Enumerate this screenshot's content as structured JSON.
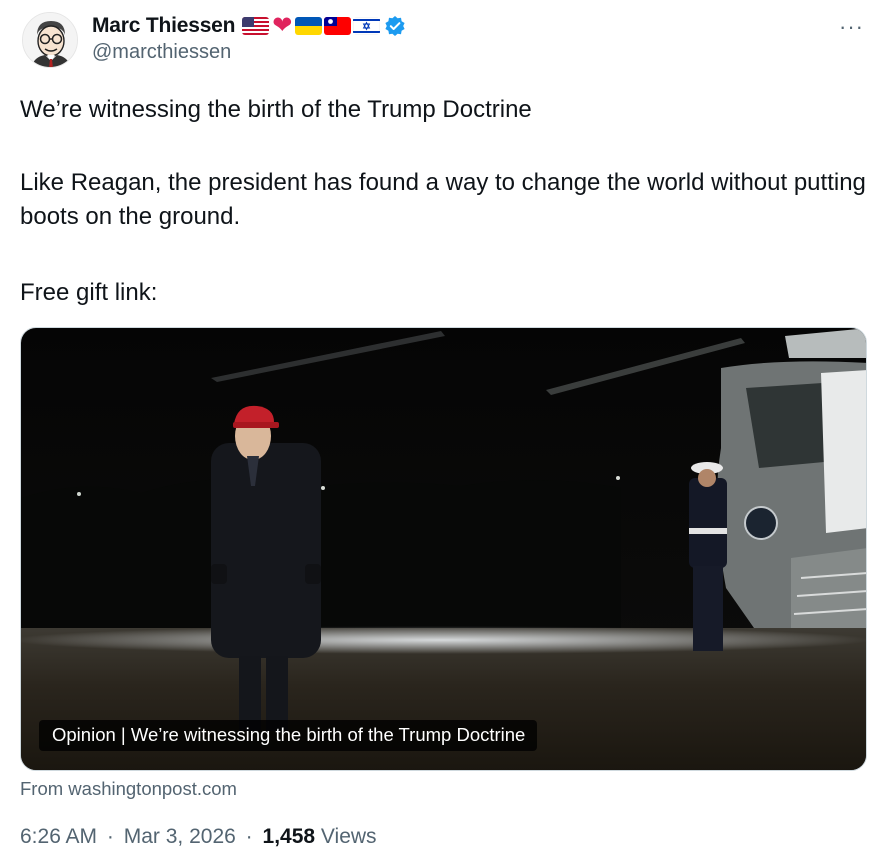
{
  "author": {
    "display_name": "Marc Thiessen",
    "handle": "@marcthiessen",
    "verified": true,
    "flags": [
      "us-flag-icon",
      "red-heart-icon",
      "ukraine-flag-icon",
      "taiwan-flag-icon",
      "israel-flag-icon"
    ]
  },
  "tweet": {
    "paragraph_1": "We’re witnessing the birth of the Trump Doctrine",
    "paragraph_2": "Like Reagan, the president has found a way to change the world without putting boots on the ground.",
    "paragraph_3": "Free gift link:"
  },
  "card": {
    "title": "Opinion | We’re witnessing the birth of the Trump Doctrine",
    "source": "From washingtonpost.com",
    "image_icon": "night-helicopter-photo"
  },
  "meta": {
    "time": "6:26 AM",
    "separator": "·",
    "date": "Mar 3, 2026",
    "views_count": "1,458",
    "views_label": "Views"
  },
  "menu": {
    "more_label": "···"
  },
  "colors": {
    "text_primary": "#0f1419",
    "text_secondary": "#536471",
    "verified_blue": "#1d9bf0",
    "border": "#cfd9de"
  }
}
